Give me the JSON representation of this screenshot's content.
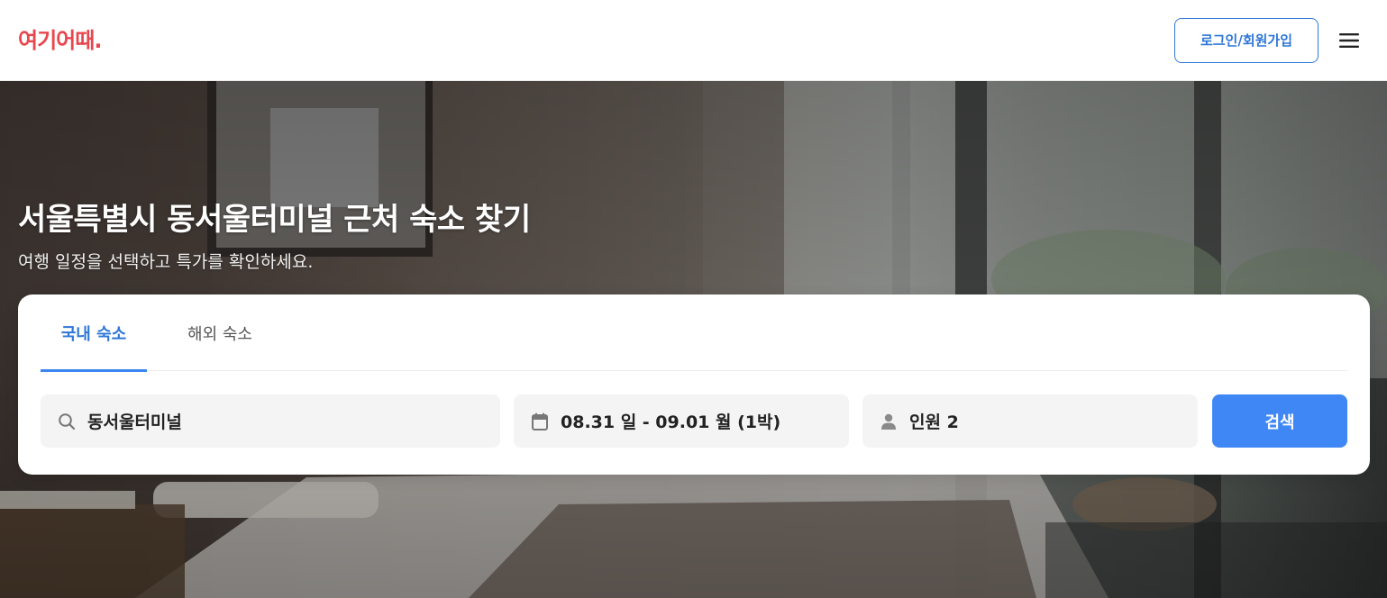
{
  "header": {
    "logo_text": "여기어때.",
    "logo_color": "#e8474e",
    "login_label": "로그인/회원가입",
    "menu_icon": "hamburger-menu-icon"
  },
  "hero": {
    "title": "서울특별시 동서울터미널 근처 숙소 찾기",
    "subtitle": "여행 일정을 선택하고 특가를 확인하세요."
  },
  "search": {
    "tabs": [
      {
        "label": "국내 숙소",
        "active": true
      },
      {
        "label": "해외 숙소",
        "active": false
      }
    ],
    "location": {
      "icon": "search-icon",
      "value": "동서울터미널"
    },
    "dates": {
      "icon": "calendar-icon",
      "value": "08.31 일 - 09.01 월 (1박)"
    },
    "guests": {
      "icon": "person-icon",
      "value": "인원 2"
    },
    "search_button_label": "검색",
    "accent_color": "#3f87f5"
  }
}
